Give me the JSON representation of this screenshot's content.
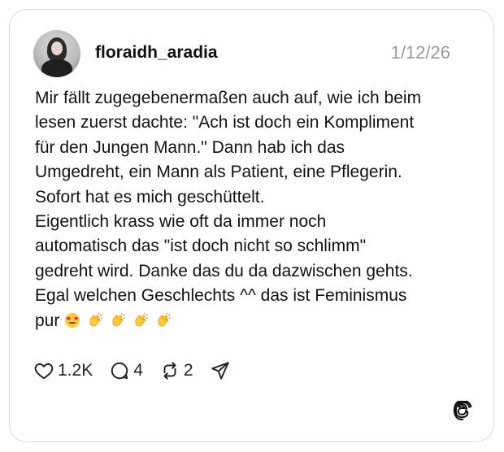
{
  "post": {
    "username": "floraidh_aradia",
    "date": "1/12/26",
    "text_lines": [
      "Mir fällt zugegebenermaßen auch auf, wie ich beim",
      "lesen zuerst dachte: \"Ach ist doch ein Kompliment",
      "für den Jungen Mann.\" Dann hab ich das",
      "Umgedreht, ein Mann als Patient, eine Pflegerin.",
      "Sofort hat es mich geschüttelt.",
      "Eigentlich krass wie oft da immer noch",
      "automatisch das \"ist doch nicht so schlimm\"",
      "gedreht wird. Danke das du da dazwischen gehts.",
      "Egal welchen Geschlechts ^^ das ist Feminismus",
      "pur"
    ],
    "emojis": [
      "heart-eyes-emoji",
      "clapping-hands-emoji",
      "clapping-hands-emoji",
      "clapping-hands-emoji",
      "clapping-hands-emoji"
    ]
  },
  "actions": {
    "likes": "1.2K",
    "replies": "4",
    "reposts": "2"
  },
  "icons": {
    "like": "heart-icon",
    "reply": "comment-bubble-icon",
    "repost": "repost-icon",
    "share": "send-icon",
    "brand": "threads-logo-icon"
  },
  "colors": {
    "text": "#111111",
    "muted": "#9a9a9a",
    "border": "#d9d9d9",
    "emoji_yellow": "#ffc83d",
    "emoji_heart": "#e8324a"
  }
}
